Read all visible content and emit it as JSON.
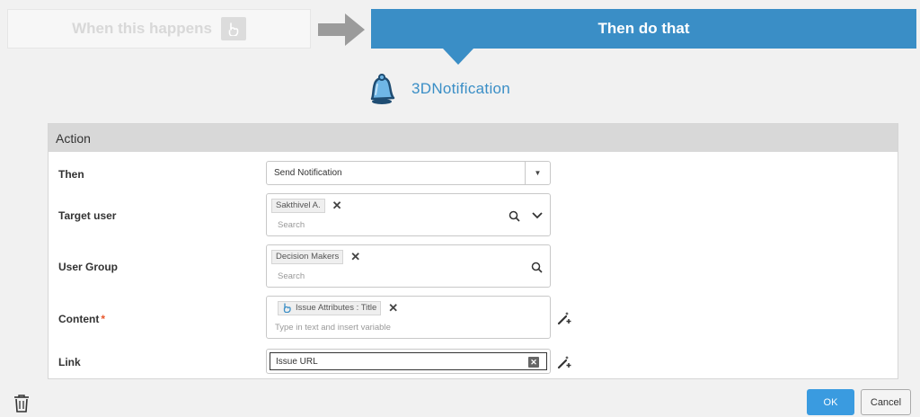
{
  "steps": {
    "when_label": "When this happens",
    "then_label": "Then do that"
  },
  "app": {
    "name": "3DNotification",
    "icon": "bell-icon"
  },
  "panel": {
    "title": "Action"
  },
  "fields": {
    "then": {
      "label": "Then",
      "value": "Send Notification"
    },
    "target_user": {
      "label": "Target user",
      "chip": "Sakthivel A.",
      "placeholder": "Search"
    },
    "user_group": {
      "label": "User Group",
      "chip": "Decision Makers",
      "placeholder": "Search"
    },
    "content": {
      "label": "Content",
      "required_mark": "*",
      "chip": "Issue Attributes : Title",
      "placeholder": "Type in text and insert variable"
    },
    "link": {
      "label": "Link",
      "value": "Issue URL"
    }
  },
  "footer": {
    "ok_label": "OK",
    "cancel_label": "Cancel"
  },
  "colors": {
    "accent": "#3a8ec6",
    "ok_button": "#3a9be0",
    "required": "#e8572c"
  }
}
